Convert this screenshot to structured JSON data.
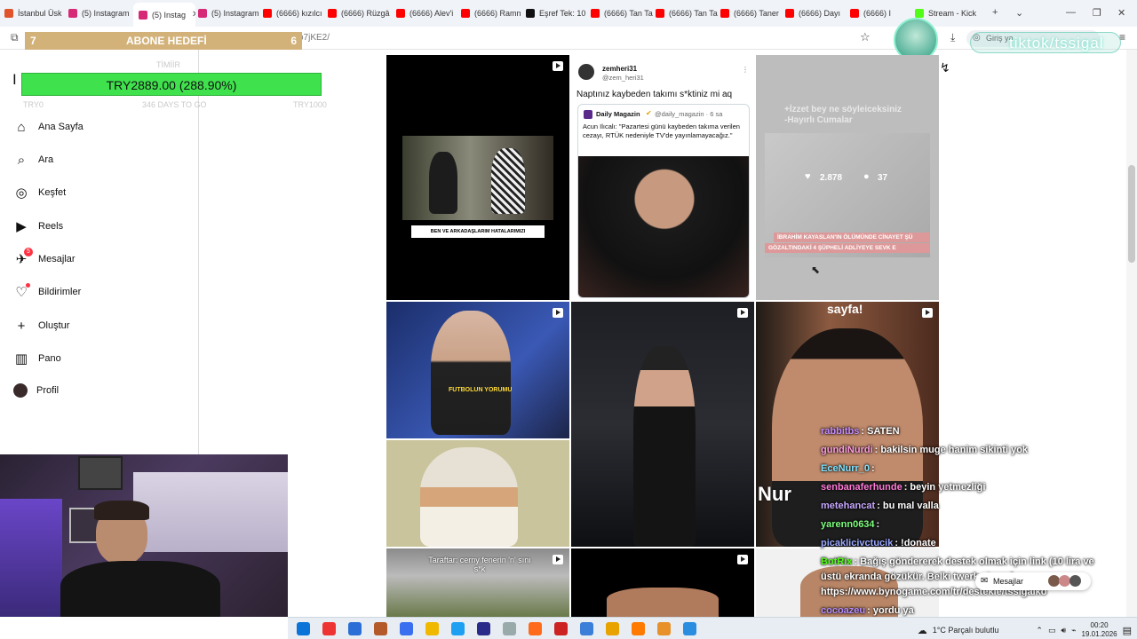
{
  "browser": {
    "tabs": [
      {
        "label": "İstanbul Üsk",
        "color": "#e0542c"
      },
      {
        "label": "(5) Instagram",
        "color": "#d62976"
      },
      {
        "label": "(5) Instag",
        "color": "#d62976",
        "active": true
      },
      {
        "label": "(5) Instagram",
        "color": "#d62976"
      },
      {
        "label": "(6666) kızılcı",
        "color": "#ff0000"
      },
      {
        "label": "(6666) Rüzgâ",
        "color": "#ff0000"
      },
      {
        "label": "(6666) Alev'i",
        "color": "#ff0000"
      },
      {
        "label": "(6666) Ramn",
        "color": "#ff0000"
      },
      {
        "label": "Eşref Tek: 10",
        "color": "#111111"
      },
      {
        "label": "(6666) Tan Ta",
        "color": "#ff0000"
      },
      {
        "label": "(6666) Tan Ta",
        "color": "#ff0000"
      },
      {
        "label": "(6666) Taner",
        "color": "#ff0000"
      },
      {
        "label": "(6666) Dayı",
        "color": "#ff0000"
      },
      {
        "label": "(6666) I",
        "color": "#ff0000"
      },
      {
        "label": "Stream - Kick",
        "color": "#53fc18"
      }
    ],
    "url_fragment": "o7jKE2/",
    "login_label": "Giriş ya"
  },
  "overlay": {
    "subgoal_left": "7",
    "subgoal_title": "ABONE HEDEFİ",
    "subgoal_right": "6",
    "donation_text": "TRY2889.00 (288.90%)",
    "ghost_title": "TİMİİR",
    "ghost_left": "TRY0",
    "ghost_mid": "346 DAYS TO GO",
    "ghost_right": "TRY1000",
    "tiktok_handle": "tiktok/tssigal"
  },
  "sidebar": {
    "items": [
      {
        "label": "Ana Sayfa",
        "icon": "home-icon"
      },
      {
        "label": "Ara",
        "icon": "search-icon"
      },
      {
        "label": "Keşfet",
        "icon": "explore-icon"
      },
      {
        "label": "Reels",
        "icon": "reels-icon"
      },
      {
        "label": "Mesajlar",
        "icon": "messages-icon",
        "badge": "5"
      },
      {
        "label": "Bildirimler",
        "icon": "heart-icon"
      },
      {
        "label": "Oluştur",
        "icon": "plus-icon"
      },
      {
        "label": "Pano",
        "icon": "dashboard-icon"
      },
      {
        "label": "Profil",
        "icon": "avatar"
      }
    ]
  },
  "feed": {
    "tile1_caption": "BEN VE ARKADAŞLARIM HATALARIMIZI PEKİŞTİRİYORUZ",
    "tweet_name": "zemheri31",
    "tweet_handle": "@zem_heri31",
    "tweet_text": "Naptınız kaybeden takımı s*ktiniz mi aq",
    "quote_name": "Daily Magazin",
    "quote_handle": "@daily_magazin · 6 sa",
    "quote_text": "Acun Ilıcalı: \"Pazartesi günü kaybeden takıma verilen cezayı, RTÜK nedeniyle TV'de yayınlamayacağız.\"",
    "tile3_line1": "+İzzet bey ne söyleiceksiniz",
    "tile3_line2": "-Hayırlı Cumalar",
    "likes": "2.878",
    "comments": "37",
    "tile3_banner1": "İBRAHİM KAYASLAN'IN ÖLÜMÜNDE CİNAYET ŞÜ",
    "tile3_banner2": "GÖZALTINDAKİ 4 ŞÜPHELİ ADLİYEYE SEVK E",
    "tile4_caption": "FUTBOLUN YORUMU",
    "tile6_top": "sayfa!",
    "tile6_side": "Nur",
    "tile9_caption": "Taraftar: cerny fenerin 'n' sını s*k"
  },
  "chat": [
    {
      "user": "rabbitbs",
      "msg": ": SATEN",
      "color": "#c88cff"
    },
    {
      "user": "gundiNurdi",
      "msg": ": bakilsin muge hanim sikinti yok",
      "color": "#ff9de0"
    },
    {
      "user": "EceNurr_0",
      "msg": ":",
      "color": "#7fe3ff"
    },
    {
      "user": "senbanaferhunde",
      "msg": ": beyin yetmezliği",
      "color": "#ff7ad9"
    },
    {
      "user": "metehancat",
      "msg": ": bu mal valla",
      "color": "#c7a7ff"
    },
    {
      "user": "yarenn0634",
      "msg": ":",
      "color": "#7dff7d"
    },
    {
      "user": "picaklicivctucik",
      "msg": ": !donate",
      "color": "#9aa9ff"
    },
    {
      "user": "BotRix",
      "msg": ": Bağış göndererek destek olmak için link (10 lira ve",
      "color": "#53fc18"
    },
    {
      "user": "",
      "msg": "üstü ekranda gözükür. Belki twerk atarım)",
      "color": "#ffffff"
    },
    {
      "user": "",
      "msg": "https://www.bynogame.com/tr/destekle/tssigalko",
      "color": "#ffffff"
    },
    {
      "user": "cocoazeu",
      "msg": ": yordu ya",
      "color": "#b58cff"
    }
  ],
  "messages_pill": "Mesajlar",
  "taskbar": {
    "weather": "1°C  Parçalı bulutlu",
    "time": "00:20",
    "date": "19.01.2026"
  }
}
